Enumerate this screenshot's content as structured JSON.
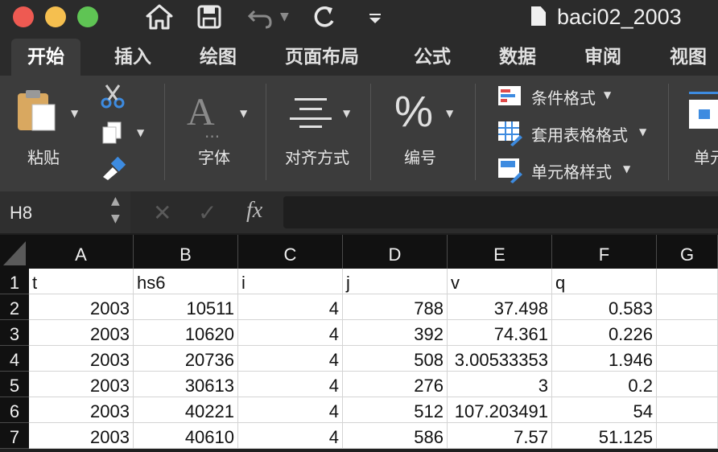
{
  "window": {
    "title": "baci02_2003"
  },
  "ribbon_tabs": [
    "开始",
    "插入",
    "绘图",
    "页面布局",
    "公式",
    "数据",
    "审阅",
    "视图"
  ],
  "ribbon": {
    "paste": "粘贴",
    "font": "字体",
    "align": "对齐方式",
    "number": "编号",
    "cond_format": "条件格式",
    "table_format": "套用表格格式",
    "cell_style": "单元格样式",
    "cells": "单元"
  },
  "formula_bar": {
    "cell_ref": "H8",
    "fx": "fx",
    "formula": ""
  },
  "grid": {
    "columns": [
      "A",
      "B",
      "C",
      "D",
      "E",
      "F",
      "G"
    ],
    "row_numbers": [
      "1",
      "2",
      "3",
      "4",
      "5",
      "6",
      "7"
    ],
    "header_row": [
      "t",
      "hs6",
      "i",
      "j",
      "v",
      "q",
      ""
    ],
    "rows": [
      [
        "2003",
        "10511",
        "4",
        "788",
        "37.498",
        "0.583",
        ""
      ],
      [
        "2003",
        "10620",
        "4",
        "392",
        "74.361",
        "0.226",
        ""
      ],
      [
        "2003",
        "20736",
        "4",
        "508",
        "3.00533353",
        "1.946",
        ""
      ],
      [
        "2003",
        "30613",
        "4",
        "276",
        "3",
        "0.2",
        ""
      ],
      [
        "2003",
        "40221",
        "4",
        "512",
        "107.203491",
        "54",
        ""
      ],
      [
        "2003",
        "40610",
        "4",
        "586",
        "7.57",
        "51.125",
        ""
      ]
    ]
  }
}
